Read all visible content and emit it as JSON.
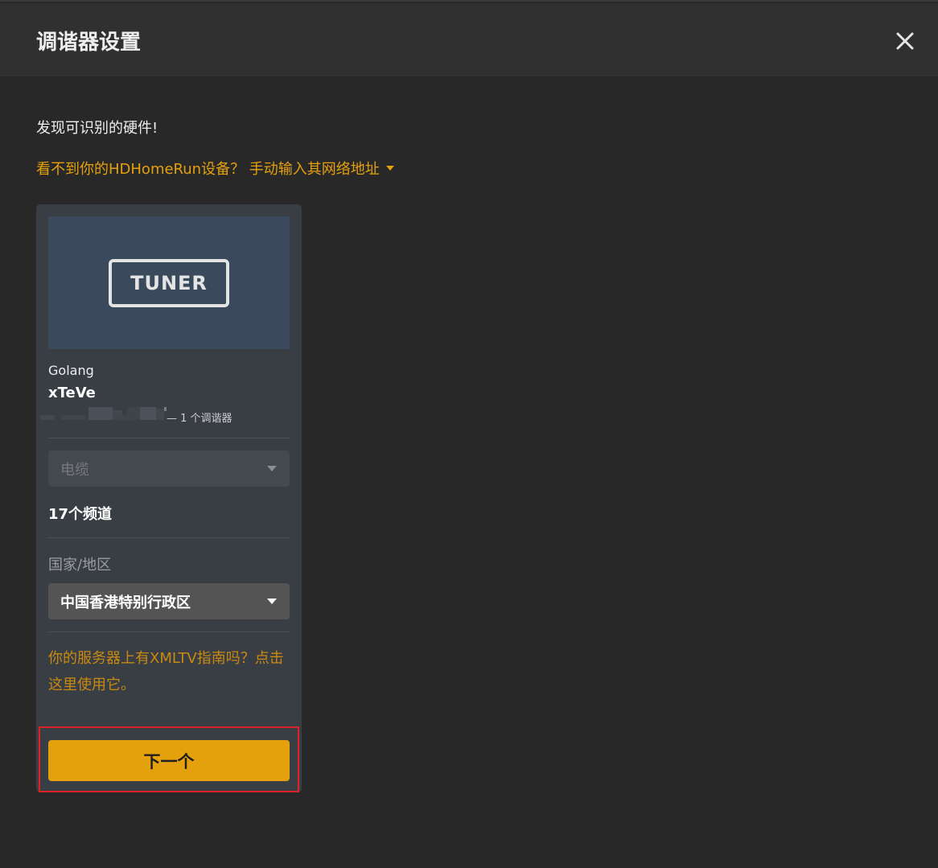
{
  "modal": {
    "title": "调谐器设置",
    "close_icon": "close-icon"
  },
  "discovery": {
    "found_text": "发现可识别的硬件!",
    "manual_link": "看不到你的HDHomeRun设备？ 手动输入其网络地址",
    "manual_link_icon": "caret-down-icon"
  },
  "device": {
    "image_label": "TUNER",
    "maker": "Golang",
    "model": "xTeVe",
    "tuner_count": "— 1 个调谐器",
    "source_select": {
      "selected": "电缆",
      "disabled": true
    },
    "channels": "17个频道",
    "country_label": "国家/地区",
    "country_select": {
      "selected": "中国香港特别行政区"
    },
    "xmltv_link": "你的服务器上有XMLTV指南吗？点击这里使用它。",
    "next_button": "下一个"
  },
  "colors": {
    "accent": "#e5a00d",
    "background": "#282828",
    "header": "#303030",
    "card": "#393d44",
    "highlight": "#e0202a"
  }
}
